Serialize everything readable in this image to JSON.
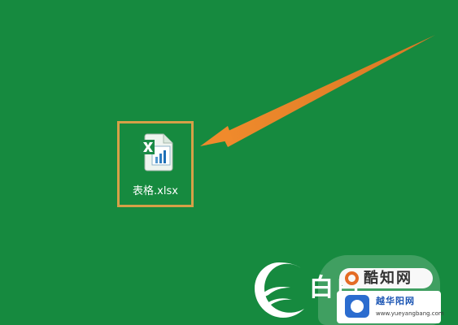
{
  "desktop": {
    "background_color": "#168a3f",
    "file": {
      "name": "表格.xlsx",
      "icon": "excel-xlsx-icon",
      "highlight_color": "#d6a047"
    },
    "annotation": {
      "color": "#f08a2c",
      "icon": "arrow-icon"
    }
  },
  "watermark": {
    "left_text": "白白",
    "site_name": "酷知网",
    "subtitle": "越华阳网",
    "url": "www.yueyangbang.com",
    "badge_color": "#e46b25"
  }
}
